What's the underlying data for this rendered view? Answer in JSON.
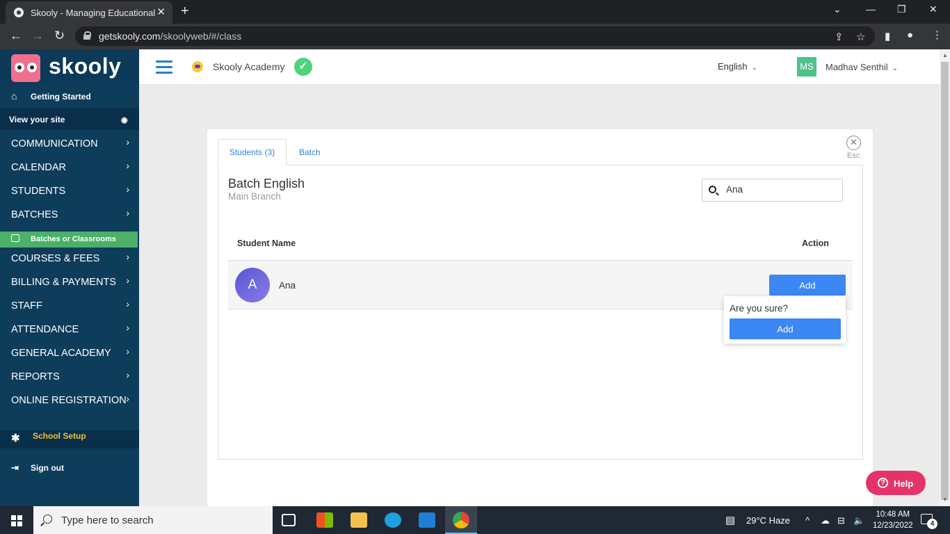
{
  "browser": {
    "tab_title": "Skooly - Managing Educational J",
    "url_domain": "getskooly.com",
    "url_path": "/skoolyweb/#/class"
  },
  "sidebar": {
    "brand": "skooly",
    "getting_started": "Getting Started",
    "view_site": "View your site",
    "menu": [
      {
        "label": "COMMUNICATION"
      },
      {
        "label": "CALENDAR"
      },
      {
        "label": "STUDENTS"
      },
      {
        "label": "BATCHES"
      },
      {
        "label": "COURSES & FEES"
      },
      {
        "label": "BILLING & PAYMENTS"
      },
      {
        "label": "STAFF"
      },
      {
        "label": "ATTENDANCE"
      },
      {
        "label": "GENERAL ACADEMY"
      },
      {
        "label": "REPORTS"
      },
      {
        "label": "ONLINE REGISTRATION"
      }
    ],
    "active_sub_item": "Batches or Classrooms",
    "school_setup": "School Setup",
    "sign_out": "Sign out"
  },
  "header": {
    "academy_name": "Skooly Academy",
    "language": "English",
    "user_initials": "MS",
    "user_name": "Madhav Senthil"
  },
  "modal": {
    "esc_label": "Esc",
    "tabs": [
      {
        "label": "Students (3)"
      },
      {
        "label": "Batch"
      }
    ],
    "batch_title": "Batch English",
    "batch_subtitle": "Main Branch",
    "search_value": "Ana",
    "table": {
      "headers": {
        "name": "Student Name",
        "action": "Action"
      },
      "rows": [
        {
          "initial": "A",
          "name": "Ana",
          "action": "Add"
        }
      ]
    },
    "confirm": {
      "question": "Are you sure?",
      "button": "Add"
    }
  },
  "help_button": "Help",
  "taskbar": {
    "search_placeholder": "Type here to search",
    "weather": "29°C  Haze",
    "time": "10:48 AM",
    "date": "12/23/2022",
    "notification_count": "4"
  },
  "colors": {
    "sidebar_bg": "#0e3c5b",
    "active_green": "#4caf6a",
    "primary_blue": "#3b87f3",
    "help_pink": "#e5336a",
    "school_setup_yellow": "#f2c230"
  }
}
